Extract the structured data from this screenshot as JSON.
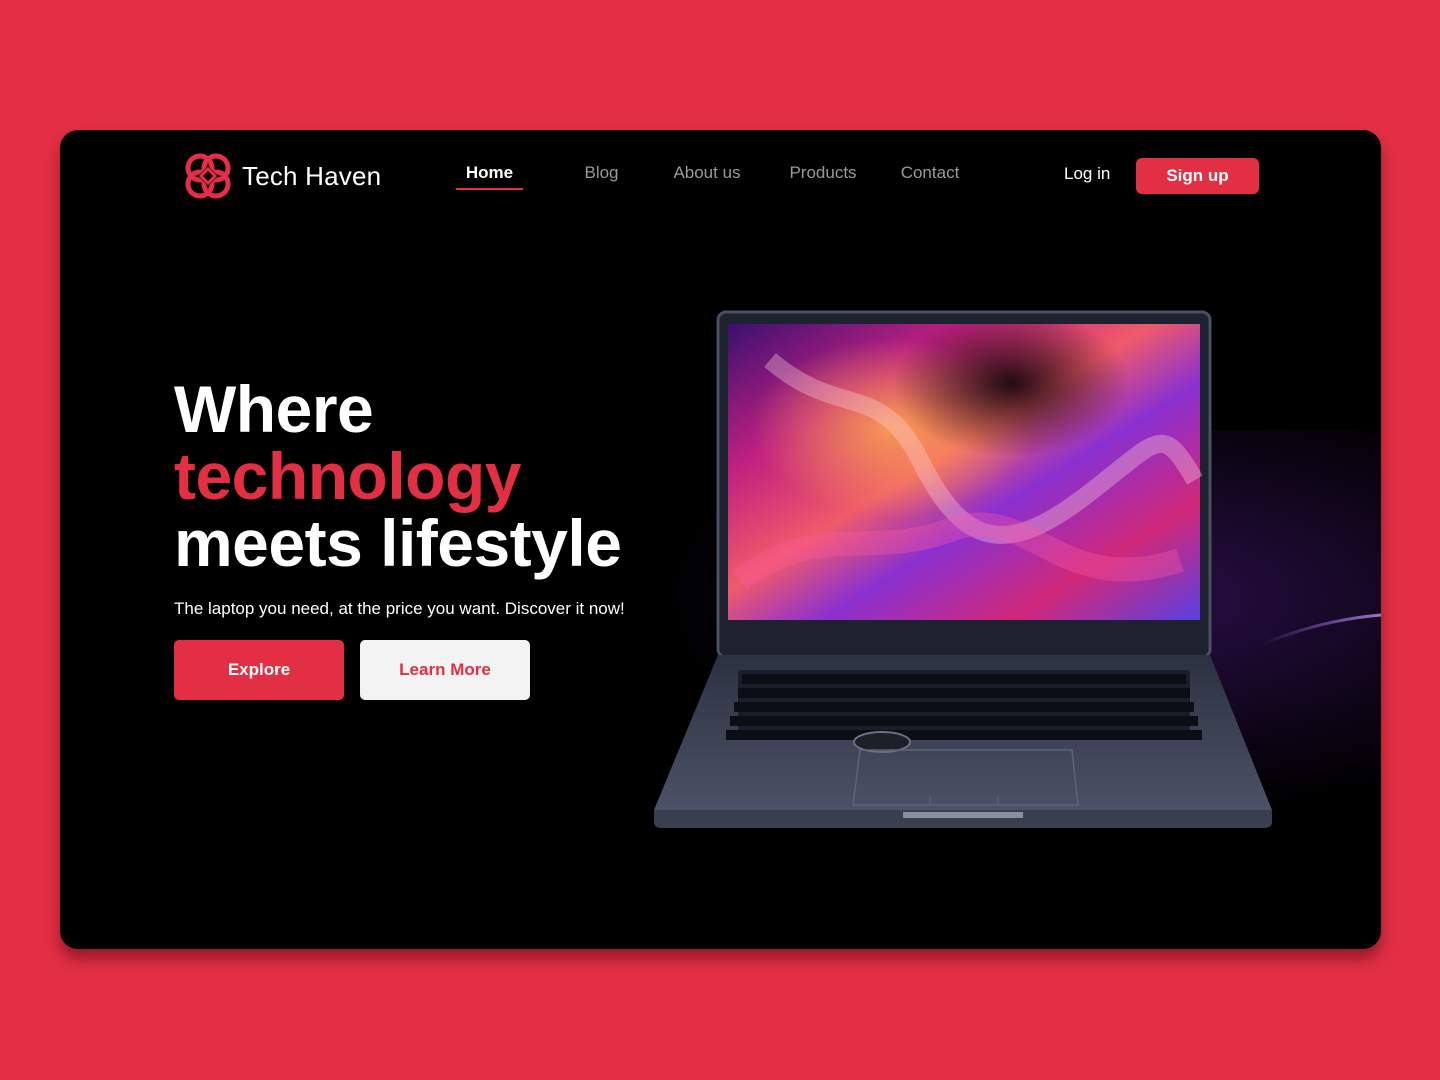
{
  "brand": {
    "name": "Tech Haven",
    "color": "#e22f44"
  },
  "nav": {
    "items": [
      {
        "label": "Home",
        "active": true
      },
      {
        "label": "Blog",
        "active": false
      },
      {
        "label": "About us",
        "active": false
      },
      {
        "label": "Products",
        "active": false
      },
      {
        "label": "Contact",
        "active": false
      }
    ]
  },
  "auth": {
    "login_label": "Log in",
    "signup_label": "Sign up"
  },
  "hero": {
    "title_line1": "Where",
    "title_accent": "technology",
    "title_line3": "meets lifestyle",
    "subtitle": "The laptop you need, at the price you want. Discover it now!",
    "explore_label": "Explore",
    "learn_more_label": "Learn More"
  },
  "icons": {
    "logo": "flower-logo-icon",
    "product_image": "laptop-image"
  },
  "colors": {
    "background": "#e22f44",
    "panel": "#000000",
    "accent": "#e22f44",
    "text": "#ffffff",
    "muted": "#9a9a9a"
  }
}
